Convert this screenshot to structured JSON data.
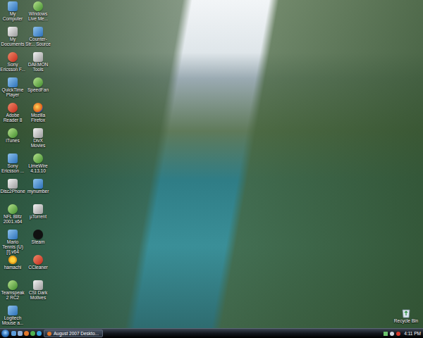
{
  "desktop_icons": [
    {
      "label": "My Computer"
    },
    {
      "label": "Windows Live Me..."
    },
    {
      "label": "My Documents"
    },
    {
      "label": "Counter-Str... Source"
    },
    {
      "label": "Sony Ericsson F..."
    },
    {
      "label": "DAEMON Tools"
    },
    {
      "label": "QuickTime Player"
    },
    {
      "label": "SpeedFan"
    },
    {
      "label": "Adobe Reader 8"
    },
    {
      "label": "Mozilla Firefox"
    },
    {
      "label": "iTunes"
    },
    {
      "label": "DivX Movies"
    },
    {
      "label": "Sony Ericsson ..."
    },
    {
      "label": "LimeWire 4.13.10"
    },
    {
      "label": "Disc2Phone"
    },
    {
      "label": "mynumber"
    },
    {
      "label": "NFL Blitz 2001.x64"
    },
    {
      "label": "µTorrent"
    },
    {
      "label": "Mario Tennis (U) [!].v64"
    },
    {
      "label": "Steam"
    },
    {
      "label": "hamachi"
    },
    {
      "label": "CCleaner"
    },
    {
      "label": "Teamspeak 2 RC2"
    },
    {
      "label": "CSI Dark Motives"
    },
    {
      "label": "Logitech Mouse a..."
    }
  ],
  "recycle_bin": {
    "label": "Recycle Bin"
  },
  "taskbar": {
    "tasks": [
      {
        "label": "August 2007 Deskto...",
        "selected": false
      }
    ],
    "clock": "4:11 PM"
  }
}
